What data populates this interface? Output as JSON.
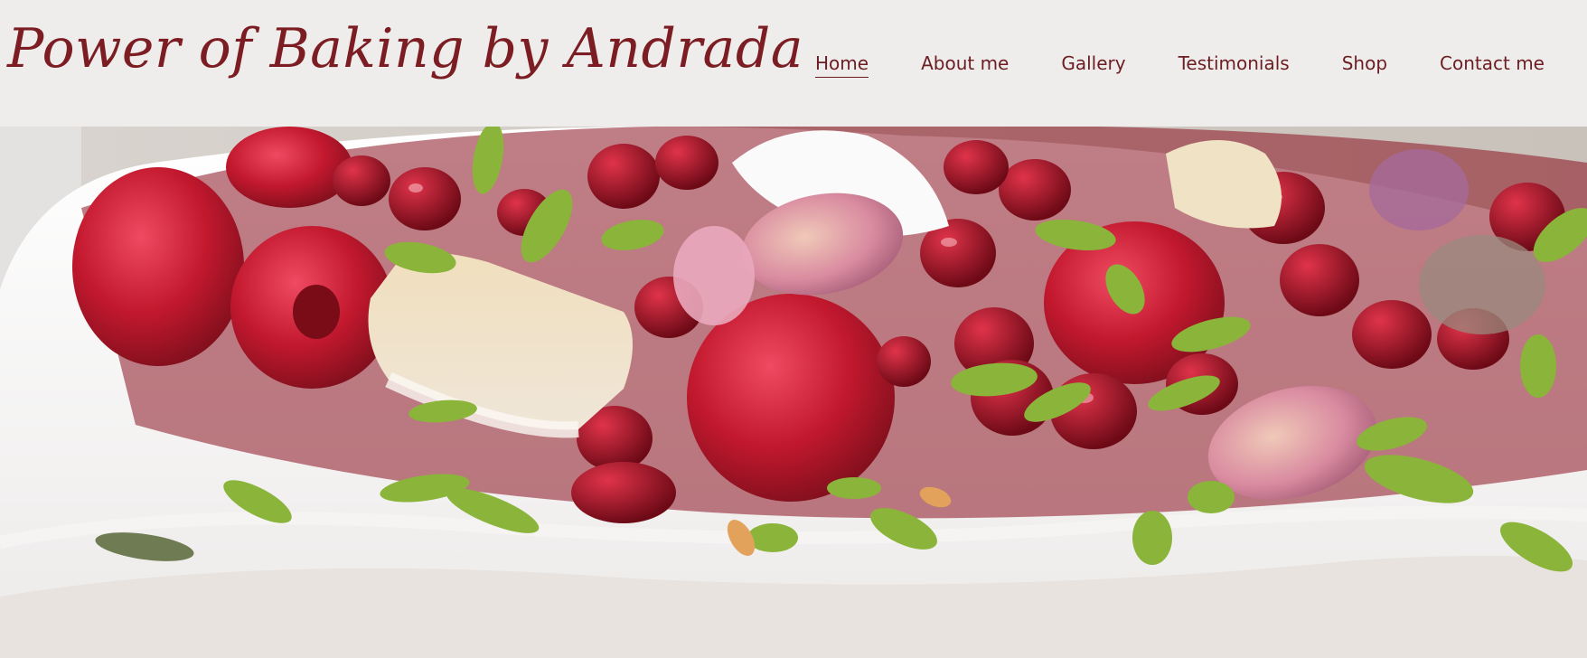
{
  "site": {
    "title": "Power of Baking by Andrada"
  },
  "nav": {
    "items": [
      {
        "label": "Home",
        "active": true
      },
      {
        "label": "About me",
        "active": false
      },
      {
        "label": "Gallery",
        "active": false
      },
      {
        "label": "Testimonials",
        "active": false
      },
      {
        "label": "Shop",
        "active": false
      },
      {
        "label": "Contact me",
        "active": false
      }
    ]
  },
  "hero": {
    "image_icon": "pavlova-dessert-image"
  },
  "colors": {
    "brand": "#7b1d22",
    "header_bg": "#efedec",
    "cream": "#fbfafa",
    "raspberry": "#c2182e",
    "pistachio": "#8bb43a",
    "rose": "#d98ba0",
    "turkish_delight": "#e9d6b4"
  }
}
